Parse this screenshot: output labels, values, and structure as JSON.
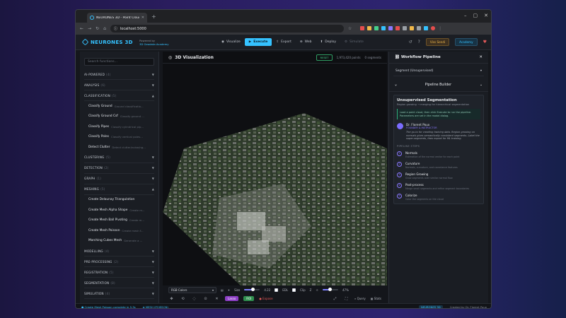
{
  "browser": {
    "tab_title": "NEURONES 3D - Point Cloud P",
    "url": "localhost:5000"
  },
  "nav": {
    "brand": "NEURONES 3D",
    "powered_by": "Powered by",
    "academy_name": "3D Geodata Academy",
    "items": [
      {
        "label": "Visualize",
        "icon": "eye-icon"
      },
      {
        "label": "Execute",
        "icon": "play-icon"
      },
      {
        "label": "Export",
        "icon": "export-icon"
      },
      {
        "label": "Web",
        "icon": "globe-icon"
      },
      {
        "label": "Deploy",
        "icon": "deploy-icon"
      },
      {
        "label": "Simulate",
        "icon": "simulate-icon"
      }
    ],
    "video_tours": "Viss Sendi",
    "academy": "Academy"
  },
  "sidebar": {
    "search_placeholder": "Search functions...",
    "cat_ai": {
      "name": "AI-POWERED",
      "count": "(4)"
    },
    "cat_analysis": {
      "name": "ANALYSIS",
      "count": "(6)"
    },
    "cat_class": {
      "name": "CLASSIFICATION",
      "count": "(5)"
    },
    "class_items": [
      {
        "label": "Classify Ground",
        "desc": "Ground classificatio..."
      },
      {
        "label": "Classify Ground Csf",
        "desc": "Classify ground ..."
      },
      {
        "label": "Classify Pipes",
        "desc": "Classify cylindrical pip..."
      },
      {
        "label": "Classify Poles",
        "desc": "Classify vertical poles..."
      },
      {
        "label": "Detect Clutter",
        "desc": "Detect clutter/noise/ng..."
      }
    ],
    "cat_cluster": {
      "name": "CLUSTERING",
      "count": "(5)"
    },
    "cat_detect": {
      "name": "DETECTION",
      "count": "(2)"
    },
    "cat_graph": {
      "name": "GRAPH",
      "count": "(1)"
    },
    "cat_mesh": {
      "name": "MESHING",
      "count": "(5)"
    },
    "mesh_items": [
      {
        "label": "Create Delaunay Triangulation",
        "desc": ""
      },
      {
        "label": "Create Mesh Alpha Shape",
        "desc": "Create m..."
      },
      {
        "label": "Create Mesh Ball Pivoting",
        "desc": "Create m..."
      },
      {
        "label": "Create Mesh Poisson",
        "desc": "Create mesh f..."
      },
      {
        "label": "Marching Cubes Mesh",
        "desc": "Generate a ..."
      }
    ],
    "cat_model": {
      "name": "MODELLING",
      "count": "(4)"
    },
    "cat_pre": {
      "name": "PRE-PROCESSING",
      "count": "(2)"
    },
    "cat_reg": {
      "name": "REGISTRATION",
      "count": "(5)"
    },
    "cat_seg": {
      "name": "SEGMENTATION",
      "count": "(8)"
    },
    "cat_sim": {
      "name": "SIMULATION",
      "count": "(4)"
    }
  },
  "viewer": {
    "title": "3D Visualization",
    "reset": "RESET",
    "points": "1,973,420 points",
    "segments": "0 segments",
    "color_mode": "RGB Colors",
    "size_label": "Size",
    "size_value": "4.22",
    "size_fraction": 0.55,
    "edl_label": "EDL",
    "clip_label": "Clip",
    "z_label": "Z",
    "opacity_value": "47%",
    "opacity_fraction": 0.47,
    "lasso": "Lasso",
    "region": "ROI",
    "expose": "Expose",
    "query": "Query",
    "stats": "Stats"
  },
  "panel": {
    "title": "Workflow Pipeline",
    "segment_select": "Segment (Unsupervised)",
    "pipeline_builder": "Pipeline Builder",
    "card_title": "Unsupervised Segmentation",
    "card_sub": "Region growing → merging for hierarchical segmentation",
    "note": "Load a point cloud, then click Execute to run the pipeline. Parameters are set in the modal dialog.",
    "author_name": "Dr. Florent Poux",
    "author_role": "FOUNDER & INSTRUCTOR",
    "quote": "The go-to for creating training data. Region growing on normals gives semantically consistent segments. Label the super-segments, then export for ML training.",
    "steps_header": "PIPELINE STEPS",
    "steps": [
      {
        "title": "Normals",
        "desc": "Estimation of the normal vector for each point"
      },
      {
        "title": "Curvature",
        "desc": "Normals, curvature, and covariance features"
      },
      {
        "title": "Region Growing",
        "desc": "Grow segments over similar normal flow"
      },
      {
        "title": "Post-process",
        "desc": "Merge small segments and refine segment boundaries"
      },
      {
        "title": "Colorize",
        "desc": "Color the segments on the cloud"
      }
    ]
  },
  "status": {
    "left": "Create Mesh Poisson complete in 5.3s",
    "mode": "MESH (POISSON)",
    "right_badge": "NEURONES 3D",
    "right_text": "Created by Dr. Florent Poux"
  },
  "colors": {
    "accent": "#35c2ff",
    "lasso": "#8e3fc7",
    "region": "#2f8f4e"
  }
}
